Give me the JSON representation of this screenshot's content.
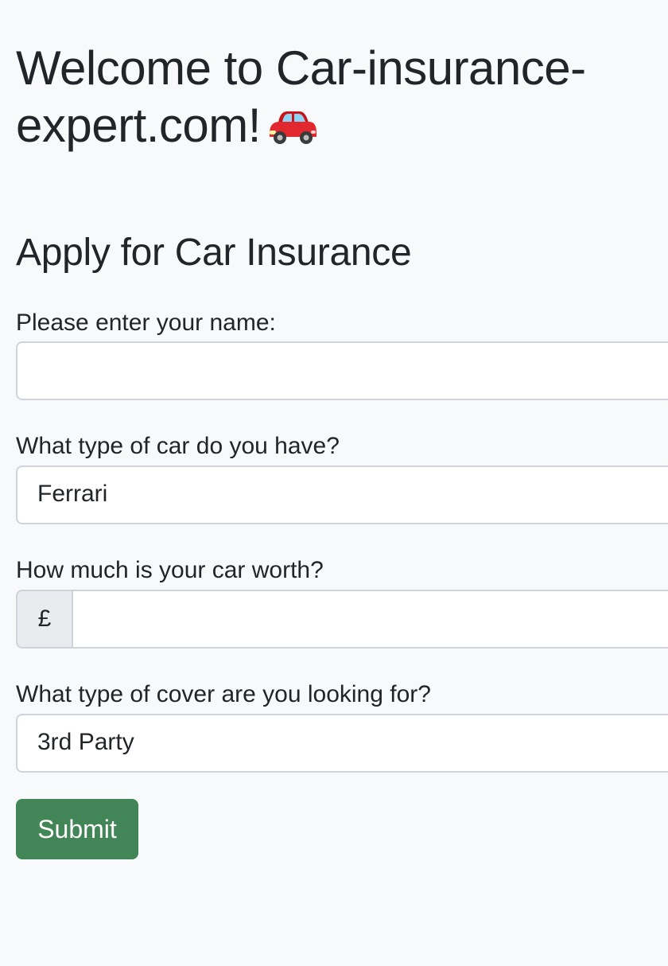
{
  "header": {
    "welcome_title": "Welcome to Car-insurance-expert.com!",
    "car_icon": "red-car-icon"
  },
  "form": {
    "title": "Apply for Car Insurance",
    "name": {
      "label": "Please enter your name:",
      "value": ""
    },
    "car_type": {
      "label": "What type of car do you have?",
      "selected": "Ferrari"
    },
    "car_worth": {
      "label": "How much is your car worth?",
      "currency_symbol": "£",
      "value": ""
    },
    "cover_type": {
      "label": "What type of cover are you looking for?",
      "selected": "3rd Party"
    },
    "submit_label": "Submit"
  },
  "colors": {
    "background": "#f8f9fa",
    "submit_button": "#428556",
    "input_border": "#ced4da",
    "addon_background": "#e9ecef",
    "car_body": "#e0282e"
  }
}
